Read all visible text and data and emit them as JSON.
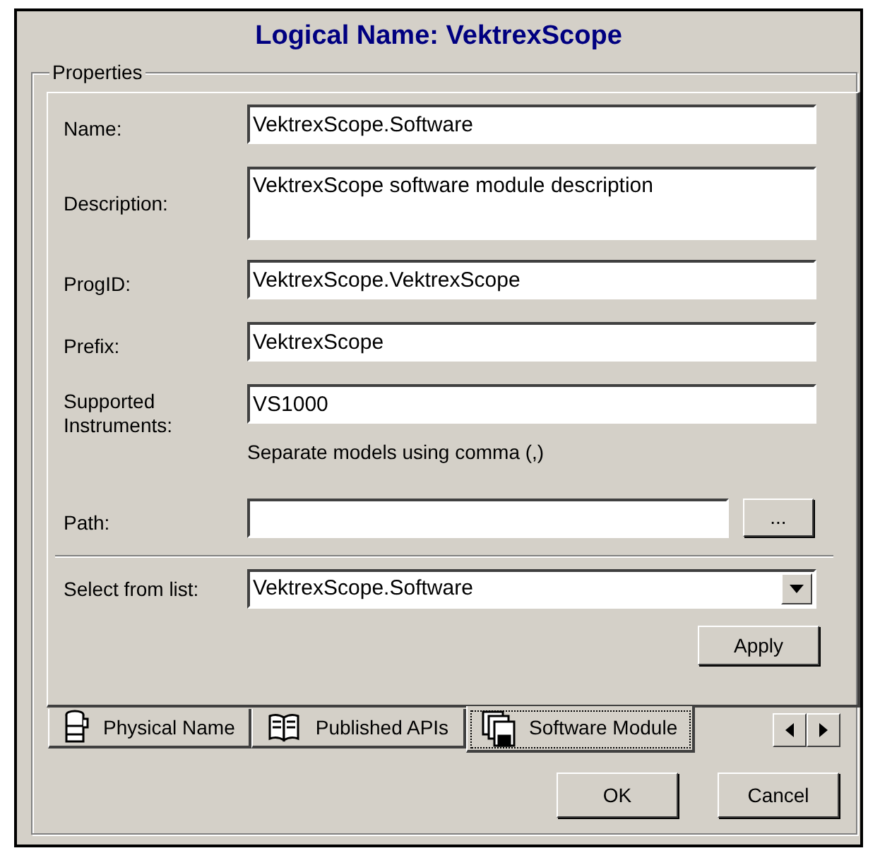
{
  "window": {
    "title": "Logical Name: VektrexScope"
  },
  "group": {
    "label": "Properties"
  },
  "fields": [
    {
      "kind": "text",
      "label": "Name:",
      "value": "VektrexScope.Software"
    },
    {
      "kind": "multiline",
      "label": "Description:",
      "value": "VektrexScope software module description"
    },
    {
      "kind": "text",
      "label": "ProgID:",
      "value": "VektrexScope.VektrexScope"
    },
    {
      "kind": "text",
      "label": "Prefix:",
      "value": "VektrexScope"
    },
    {
      "kind": "text",
      "label": "Supported Instruments:",
      "value": "VS1000",
      "hint": "Separate models using comma (,)"
    },
    {
      "kind": "browse",
      "label": "Path:",
      "button": "..."
    }
  ],
  "select": {
    "label": "Select from list:",
    "value": "VektrexScope.Software"
  },
  "apply_button": "Apply",
  "tabs": [
    {
      "label": "Physical Name",
      "kind": "can",
      "selected": false
    },
    {
      "label": "Published APIs",
      "kind": "book",
      "selected": false
    },
    {
      "label": "Software Module",
      "kind": "disks",
      "selected": true
    }
  ],
  "buttons": [
    "OK",
    "Cancel"
  ]
}
